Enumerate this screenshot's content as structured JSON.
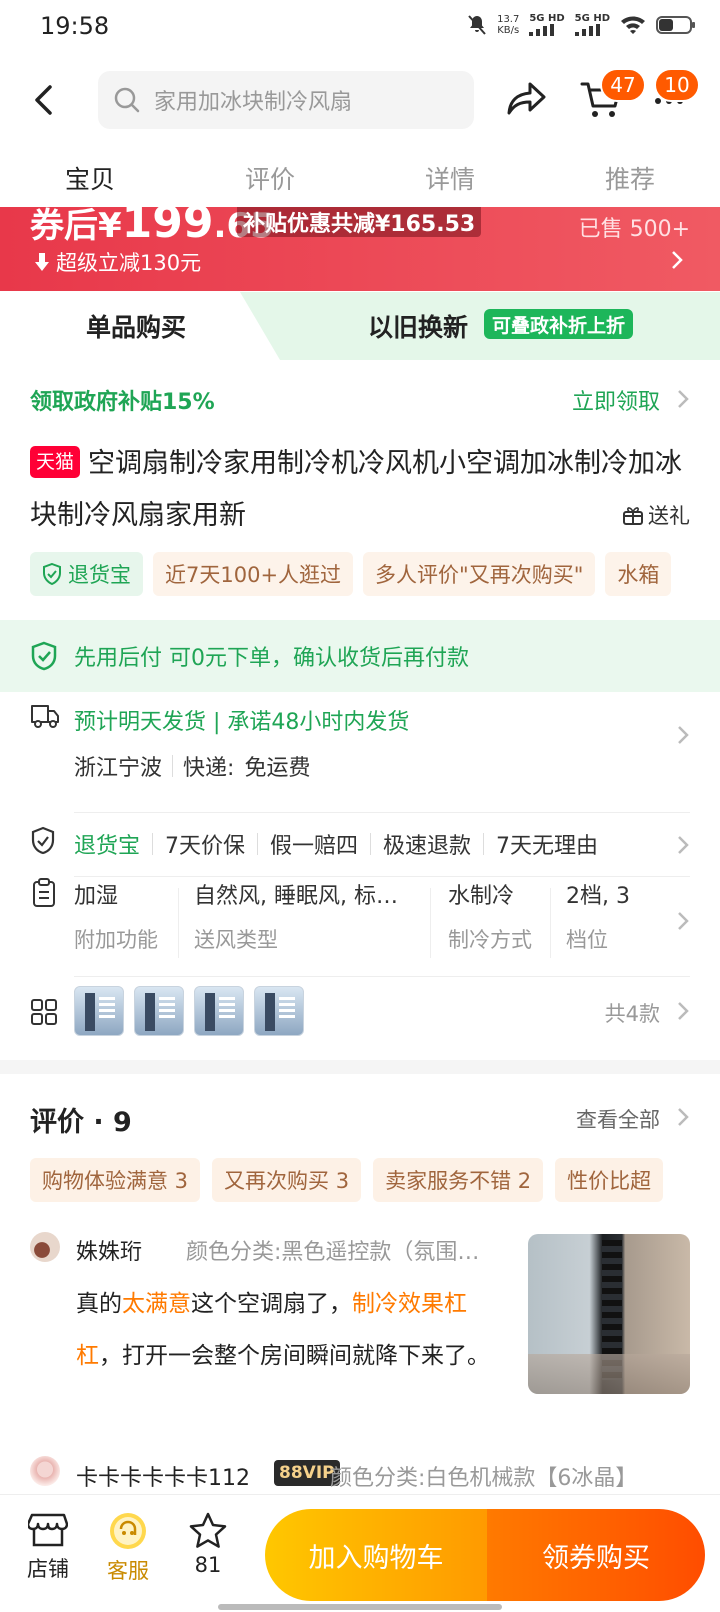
{
  "status": {
    "time": "19:58",
    "speed": "13.7",
    "speed_unit": "KB/s",
    "net1": "5G HD",
    "net2": "5G HD"
  },
  "search": {
    "placeholder": "家用加冰块制冷风扇"
  },
  "header": {
    "cart_badge": "47",
    "more_badge": "10"
  },
  "tabs": [
    "宝贝",
    "评价",
    "详情",
    "推荐"
  ],
  "price": {
    "prefix": "券后",
    "currency": "¥",
    "amount": "199",
    "decimal": ".65",
    "subsidy": "补贴优惠共减¥165.53",
    "sold": "已售 500+",
    "instant_cut": "超级立减130元"
  },
  "buy_mode": {
    "single": "单品购买",
    "trade_in": "以旧换新",
    "trade_in_tag": "可叠政补折上折"
  },
  "gov_subsidy": {
    "label": "领取政府补贴15%",
    "action": "立即领取"
  },
  "product": {
    "store_badge": "天猫",
    "title": "空调扇制冷家用制冷机冷风机小空调加冰制冷加冰块制冷风扇家用新",
    "gift": "送礼"
  },
  "tags": [
    "退货宝",
    "近7天100+人逛过",
    "多人评价\"又再次购买\"",
    "水箱"
  ],
  "pay_later": "先用后付 可0元下单，确认收货后再付款",
  "shipping": {
    "promise": "预计明天发货 | 承诺48小时内发货",
    "origin": "浙江宁波",
    "courier_label": "快递:",
    "fee": "免运费"
  },
  "services": [
    "退货宝",
    "7天价保",
    "假一赔四",
    "极速退款",
    "7天无理由"
  ],
  "attributes": [
    {
      "value": "加湿",
      "key": "附加功能"
    },
    {
      "value": "自然风, 睡眠风, 标…",
      "key": "送风类型"
    },
    {
      "value": "水制冷",
      "key": "制冷方式"
    },
    {
      "value": "2档, 3",
      "key": "档位"
    }
  ],
  "variants": {
    "count_label": "共4款"
  },
  "reviews": {
    "title": "评价 · 9",
    "view_all": "查看全部",
    "tags": [
      "购物体验满意 3",
      "又再次购买 3",
      "卖家服务不错 2",
      "性价比超"
    ],
    "items": [
      {
        "user": "姝姝珩",
        "spec": "颜色分类:黑色遥控款（氛围…",
        "seg1": "真的",
        "hl1": "太满意",
        "seg2": "这个空调扇了，",
        "hl2": "制冷效果杠杠",
        "seg3": "，打开一会整个房间瞬间就降下来了。"
      },
      {
        "user": "卡卡卡卡卡卡112",
        "vip": "88VIP",
        "spec": "颜色分类:白色机械款【6冰晶】"
      }
    ]
  },
  "bottom_bar": {
    "shop": "店铺",
    "service": "客服",
    "favorites": "81",
    "add_to_cart": "加入购物车",
    "buy": "领券购买"
  },
  "colors": {
    "brand_red": "#e8384a",
    "green": "#1fa555",
    "orange": "#ff7a00",
    "yellow": "#ffc700"
  }
}
